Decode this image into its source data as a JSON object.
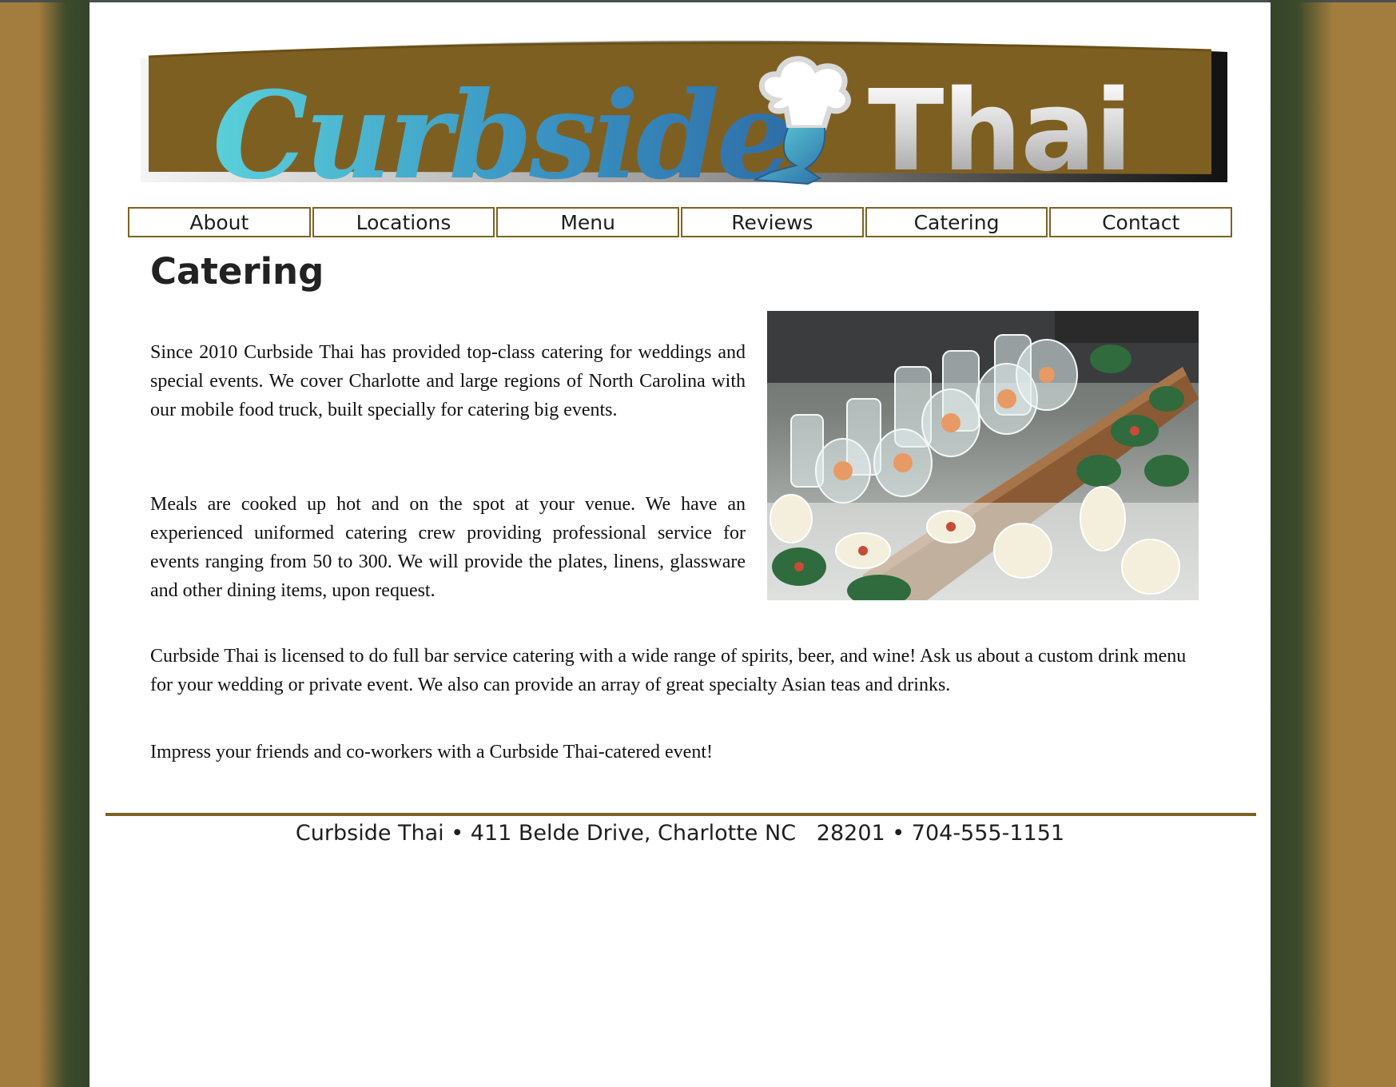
{
  "banner": {
    "logo_text_left": "Curbside",
    "logo_text_right": "Thai",
    "icon": "chef-hat-icon",
    "background_color": "#7e5f22"
  },
  "nav": {
    "items": [
      {
        "label": "About"
      },
      {
        "label": "Locations"
      },
      {
        "label": "Menu"
      },
      {
        "label": "Reviews"
      },
      {
        "label": "Catering"
      },
      {
        "label": "Contact"
      }
    ]
  },
  "main": {
    "title": "Catering",
    "paragraphs": [
      "Since 2010 Curbside Thai has provided top-class catering for weddings and special events. We cover Charlotte and large regions of North Carolina with our mobile food truck, built specially for catering big events.",
      "Meals are cooked up hot and on the spot at your venue. We have an experienced uniformed catering crew providing professional service for events ranging from 50 to 300. We will provide the plates, linens, glassware and other dining items, upon request.",
      "Curbside Thai is licensed to do full bar service catering with a wide range of spirits, beer, and wine! Ask us about a custom drink menu for your wedding or private event. We also can provide an array of great specialty Asian teas and drinks.",
      "Impress your friends and co-workers with a Curbside Thai-catered event!"
    ],
    "image": "catering-food-photo"
  },
  "footer": {
    "text": "Curbside Thai • 411 Belde Drive, Charlotte NC   28201 • 704-555-1151"
  },
  "colors": {
    "page_background": "#a37d3d",
    "side_shadow": "#3c4a2c",
    "accent": "#7c6325"
  }
}
